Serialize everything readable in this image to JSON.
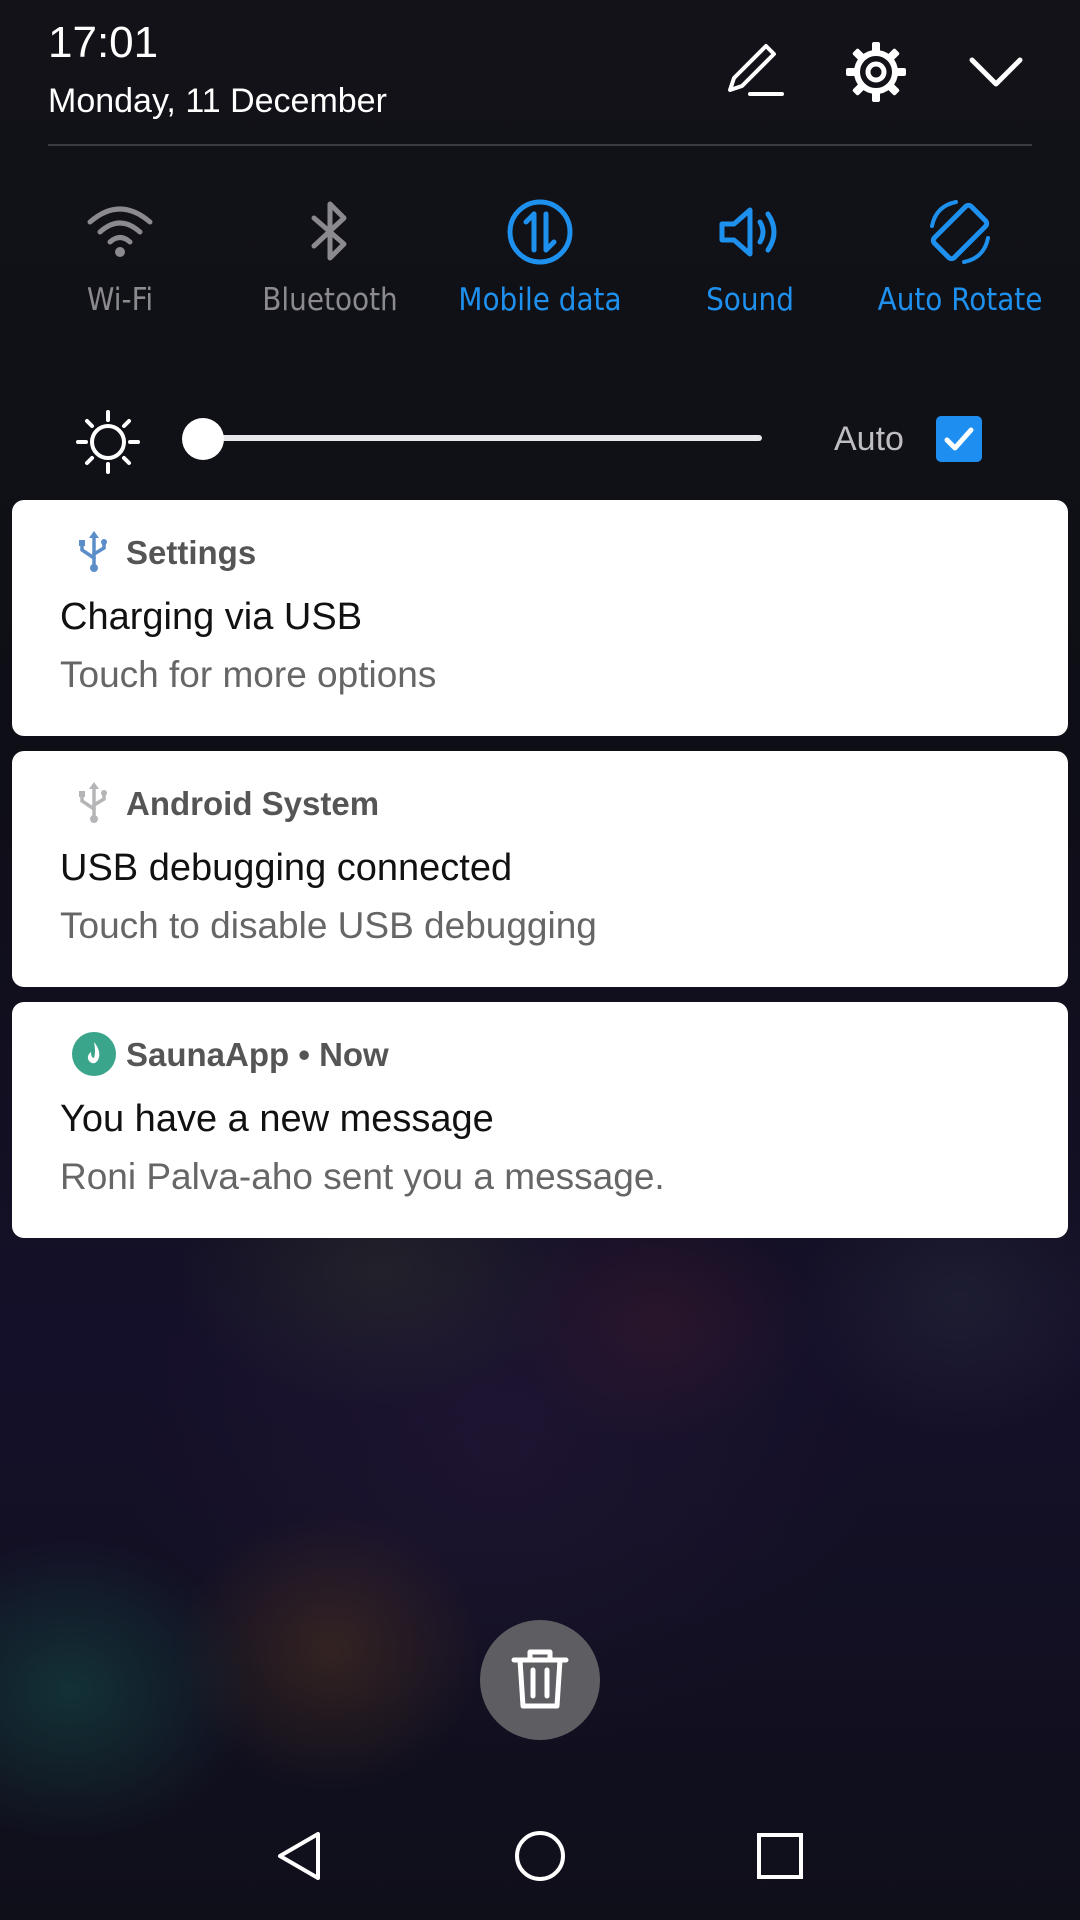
{
  "header": {
    "time": "17:01",
    "date": "Monday, 11 December"
  },
  "top_actions": {
    "icons": [
      "pencil-icon",
      "gear-icon",
      "chevron-down-icon"
    ]
  },
  "quick_settings": {
    "tiles": [
      {
        "label": "Wi-Fi",
        "icon": "wifi-icon",
        "active": false
      },
      {
        "label": "Bluetooth",
        "icon": "bluetooth-icon",
        "active": false
      },
      {
        "label": "Mobile data",
        "icon": "mobile-data-icon",
        "active": true
      },
      {
        "label": "Sound",
        "icon": "speaker-icon",
        "active": true
      },
      {
        "label": "Auto Rotate",
        "icon": "rotate-icon",
        "active": true
      }
    ],
    "active_color": "#1e90ee",
    "inactive_color": "#8b8b8f"
  },
  "brightness": {
    "level": 0.0,
    "auto_label": "Auto",
    "auto_checked": true
  },
  "notifications": [
    {
      "app": "Settings",
      "title": "Charging via USB",
      "body": "Touch for more options",
      "icon": "usb-icon"
    },
    {
      "app": "Android System",
      "title": "USB debugging connected",
      "body": "Touch to disable USB debugging",
      "icon": "usb-icon"
    },
    {
      "app": "SaunaApp • Now",
      "title": "You have a new message",
      "body": "Roni Palva-aho sent you a message.",
      "icon": "sauna-app-icon",
      "icon_color": "#3aa58a"
    }
  ],
  "clear_all": {
    "icon": "trash-icon"
  },
  "nav_bar": {
    "icons": [
      "back-icon",
      "home-icon",
      "recents-icon"
    ]
  }
}
